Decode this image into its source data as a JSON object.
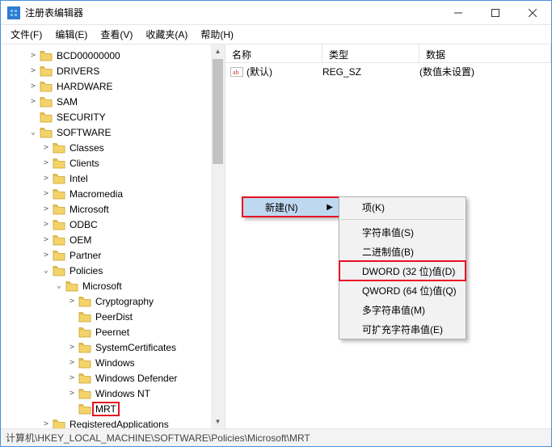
{
  "window": {
    "title": "注册表编辑器"
  },
  "menubar": [
    "文件(F)",
    "编辑(E)",
    "查看(V)",
    "收藏夹(A)",
    "帮助(H)"
  ],
  "tree": [
    {
      "depth": 1,
      "toggle": ">",
      "label": "BCD00000000"
    },
    {
      "depth": 1,
      "toggle": ">",
      "label": "DRIVERS"
    },
    {
      "depth": 1,
      "toggle": ">",
      "label": "HARDWARE"
    },
    {
      "depth": 1,
      "toggle": ">",
      "label": "SAM"
    },
    {
      "depth": 1,
      "toggle": "",
      "label": "SECURITY"
    },
    {
      "depth": 1,
      "toggle": "v",
      "label": "SOFTWARE"
    },
    {
      "depth": 2,
      "toggle": ">",
      "label": "Classes"
    },
    {
      "depth": 2,
      "toggle": ">",
      "label": "Clients"
    },
    {
      "depth": 2,
      "toggle": ">",
      "label": "Intel"
    },
    {
      "depth": 2,
      "toggle": ">",
      "label": "Macromedia"
    },
    {
      "depth": 2,
      "toggle": ">",
      "label": "Microsoft"
    },
    {
      "depth": 2,
      "toggle": ">",
      "label": "ODBC"
    },
    {
      "depth": 2,
      "toggle": ">",
      "label": "OEM"
    },
    {
      "depth": 2,
      "toggle": ">",
      "label": "Partner"
    },
    {
      "depth": 2,
      "toggle": "v",
      "label": "Policies"
    },
    {
      "depth": 3,
      "toggle": "v",
      "label": "Microsoft"
    },
    {
      "depth": 4,
      "toggle": ">",
      "label": "Cryptography"
    },
    {
      "depth": 4,
      "toggle": "",
      "label": "PeerDist"
    },
    {
      "depth": 4,
      "toggle": "",
      "label": "Peernet"
    },
    {
      "depth": 4,
      "toggle": ">",
      "label": "SystemCertificates"
    },
    {
      "depth": 4,
      "toggle": ">",
      "label": "Windows"
    },
    {
      "depth": 4,
      "toggle": ">",
      "label": "Windows Defender"
    },
    {
      "depth": 4,
      "toggle": ">",
      "label": "Windows NT"
    },
    {
      "depth": 4,
      "toggle": "",
      "label": "MRT",
      "selected": true
    },
    {
      "depth": 2,
      "toggle": ">",
      "label": "RegisteredApplications"
    }
  ],
  "list": {
    "headers": {
      "name": "名称",
      "type": "类型",
      "data": "数据"
    },
    "rows": [
      {
        "name": "(默认)",
        "type": "REG_SZ",
        "data": "(数值未设置)"
      }
    ]
  },
  "contextmenu1": {
    "label": "新建(N)"
  },
  "contextmenu2": [
    {
      "label": "项(K)",
      "kind": "item"
    },
    {
      "kind": "sep"
    },
    {
      "label": "字符串值(S)",
      "kind": "item"
    },
    {
      "label": "二进制值(B)",
      "kind": "item"
    },
    {
      "label": "DWORD (32 位)值(D)",
      "kind": "item",
      "highlight": true
    },
    {
      "label": "QWORD (64 位)值(Q)",
      "kind": "item"
    },
    {
      "label": "多字符串值(M)",
      "kind": "item"
    },
    {
      "label": "可扩充字符串值(E)",
      "kind": "item"
    }
  ],
  "statusbar": "计算机\\HKEY_LOCAL_MACHINE\\SOFTWARE\\Policies\\Microsoft\\MRT",
  "icons": {
    "folder_fill": "#f4d36b",
    "folder_stroke": "#c9a227"
  }
}
